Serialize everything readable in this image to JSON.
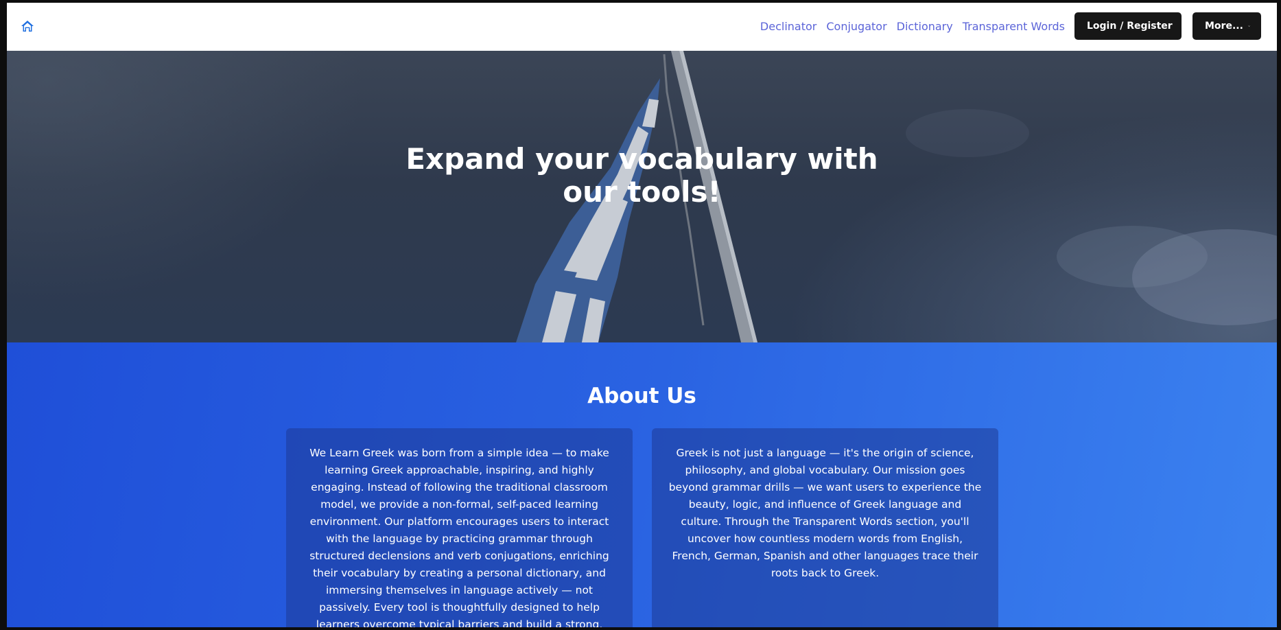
{
  "nav": {
    "home_icon": "home-icon",
    "links": [
      "Declinator",
      "Conjugator",
      "Dictionary",
      "Transparent Words"
    ],
    "login_label": "Login / Register",
    "more_label": "More...",
    "link_color": "#5b64d8",
    "button_color": "#171717"
  },
  "hero": {
    "title": "Expand your vocabulary with our tools!"
  },
  "about": {
    "title": "About Us",
    "card1": "We Learn Greek was born from a simple idea — to make learning Greek approachable, inspiring, and highly engaging. Instead of following the traditional classroom model, we provide a non-formal, self-paced learning environment. Our platform encourages users to interact with the language by practicing grammar through structured declensions and verb conjugations, enriching their vocabulary by creating a personal dictionary, and immersing themselves in language actively — not passively. Every tool is thoughtfully designed to help learners overcome typical barriers and build a strong, practical command of Greek.",
    "card2": "Greek is not just a language — it's the origin of science, philosophy, and global vocabulary. Our mission goes beyond grammar drills — we want users to experience the beauty, logic, and influence of Greek language and culture. Through the Transparent Words section, you'll uncover how countless modern words from English, French, German, Spanish and other languages trace their roots back to Greek.",
    "bg_start": "#1f4fd8",
    "bg_end": "#3b82f0"
  }
}
